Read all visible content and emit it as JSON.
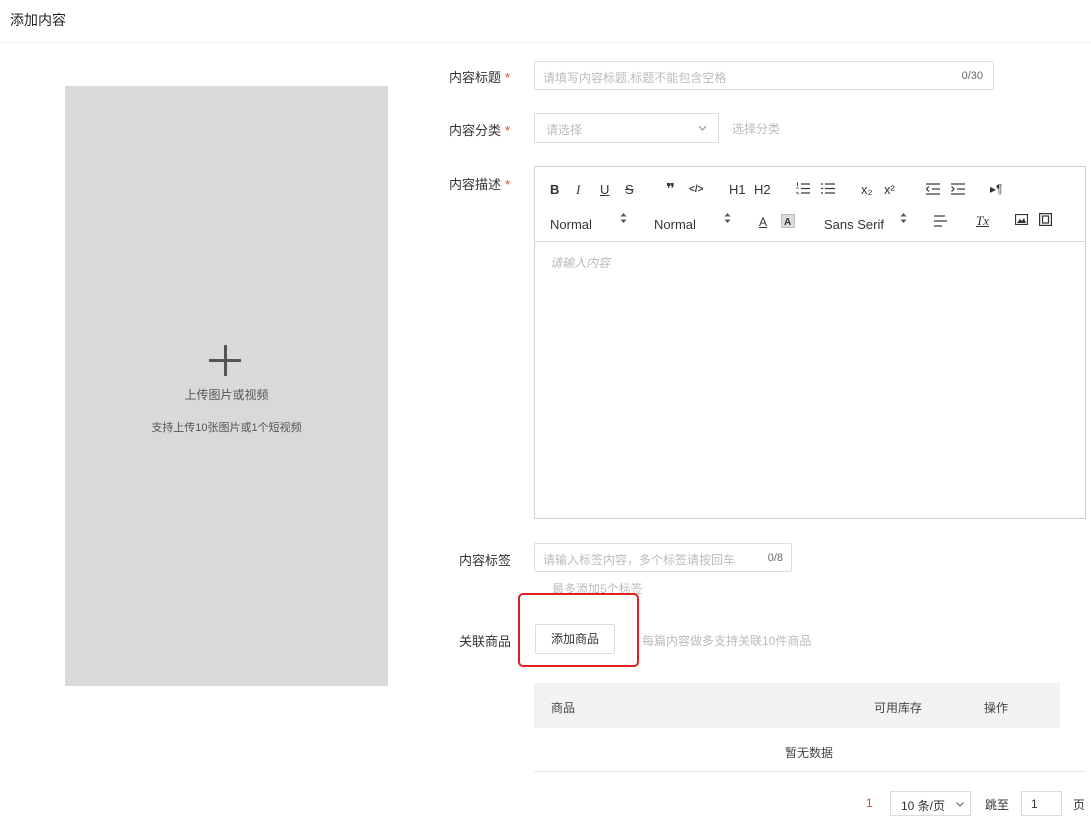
{
  "page": {
    "title": "添加内容"
  },
  "upload": {
    "title": "上传图片或视频",
    "hint": "支持上传10张图片或1个短视频"
  },
  "form": {
    "title_label": "内容标题",
    "title_placeholder": "请填写内容标题,标题不能包含空格",
    "title_counter": "0/30",
    "category_label": "内容分类",
    "category_placeholder": "请选择",
    "category_hint": "选择分类",
    "desc_label": "内容描述",
    "desc_placeholder": "请输入内容",
    "tags_label": "内容标签",
    "tags_placeholder": "请输入标签内容，多个标签请按回车",
    "tags_counter": "0/8",
    "tags_hint": "最多添加5个标签",
    "products_label": "关联商品",
    "add_product_label": "添加商品",
    "products_hint": "每篇内容做多支持关联10件商品",
    "required_mark": "*"
  },
  "editor": {
    "toolbar_row1": [
      "B",
      "I",
      "U",
      "S",
      "❞",
      "</>",
      "H1",
      "H2",
      "ordered-list",
      "bullet-list",
      "x₂",
      "x²",
      "outdent",
      "indent",
      "▸¶"
    ],
    "header_select": "Normal",
    "size_select": "Normal",
    "font_select": "Sans Serif",
    "color_letter": "A",
    "clear_format": "Tx"
  },
  "table": {
    "columns": [
      "商品",
      "可用库存",
      "操作"
    ],
    "empty_text": "暂无数据"
  },
  "pagination": {
    "current_page": "1",
    "page_size": "10 条/页",
    "goto_label": "跳至",
    "goto_value": "1",
    "page_suffix": "页"
  },
  "colors": {
    "required": "#e93b3b",
    "highlight_box": "#e02020",
    "upload_bg": "#d9d9d9",
    "pager_current": "#e0452f"
  }
}
